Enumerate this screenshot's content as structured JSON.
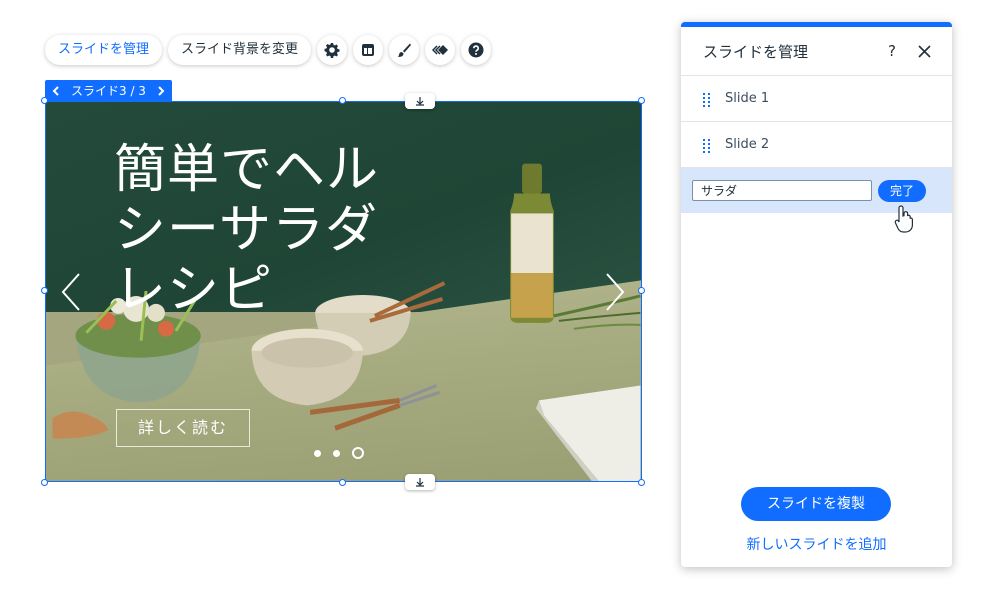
{
  "toolbar": {
    "manage_slides": "スライドを管理",
    "change_background": "スライド背景を変更",
    "icons": [
      "gear-icon",
      "layout-icon",
      "brush-icon",
      "animation-icon",
      "help-icon"
    ]
  },
  "slide_tag": {
    "label": "スライド3 / 3"
  },
  "slide": {
    "headline": "簡単でヘルシーサラダレシピ",
    "button": "詳しく読む",
    "dots": 3,
    "current_dot": 3
  },
  "panel": {
    "title": "スライドを管理",
    "help": "?",
    "items": [
      {
        "label": "Slide 1"
      },
      {
        "label": "Slide 2"
      }
    ],
    "editing_value": "サラダ",
    "done": "完了",
    "duplicate": "スライドを複製",
    "add_new": "新しいスライドを追加"
  },
  "colors": {
    "accent": "#116dff",
    "selected_row": "#d8e6fb",
    "wall": "#234a3b",
    "table": "#a7ab80"
  }
}
